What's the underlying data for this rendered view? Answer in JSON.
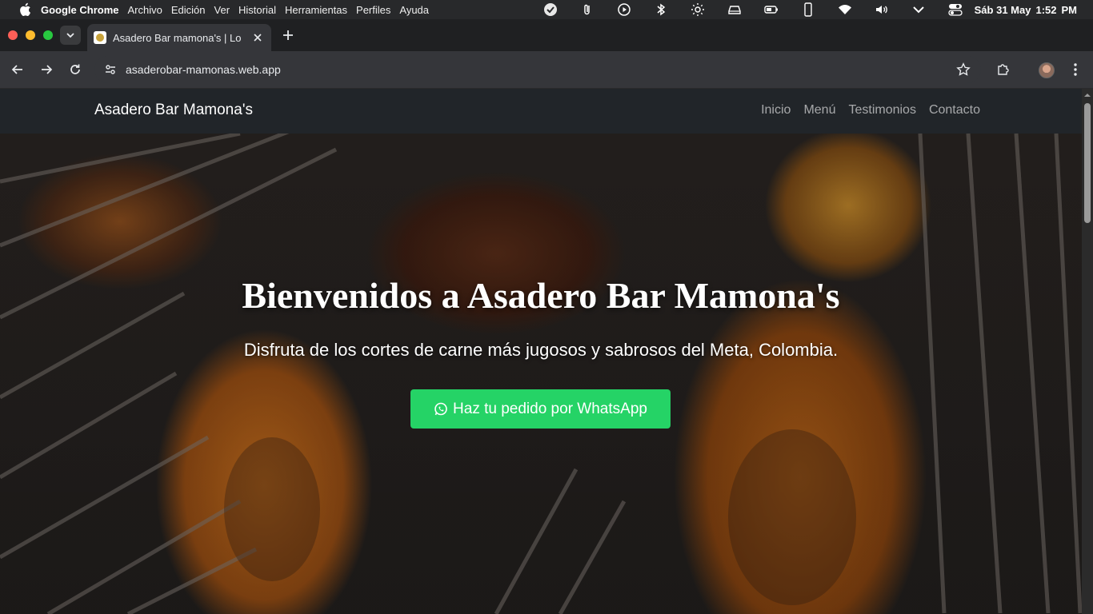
{
  "mac_menubar": {
    "app_name": "Google Chrome",
    "menu_items": [
      "Archivo",
      "Edición",
      "Ver",
      "Historial",
      "Herramientas",
      "Perfiles",
      "Ayuda"
    ],
    "date": "Sáb 31 May",
    "time": "1:52",
    "ampm": "PM"
  },
  "browser": {
    "tab_title": "Asadero Bar mamona's | Lo",
    "url": "asaderobar-mamonas.web.app"
  },
  "site": {
    "brand": "Asadero Bar Mamona's",
    "nav": [
      "Inicio",
      "Menú",
      "Testimonios",
      "Contacto"
    ],
    "hero_title": "Bienvenidos a Asadero Bar Mamona's",
    "hero_subtitle": "Disfruta de los cortes de carne más jugosos y sabrosos del Meta, Colombia.",
    "cta_label": "Haz tu pedido por WhatsApp",
    "cta_color": "#25d366",
    "nav_bg": "#212529"
  }
}
